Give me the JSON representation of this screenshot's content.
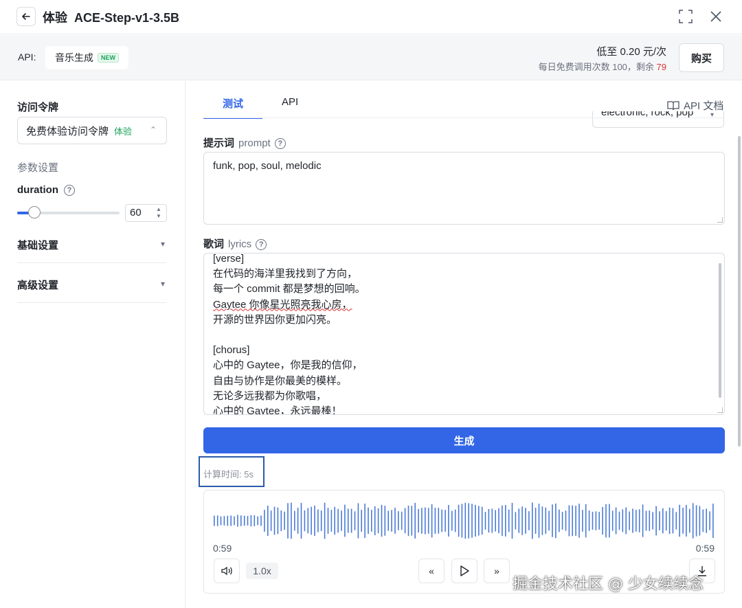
{
  "header": {
    "title": "体验  ACE-Step-v1-3.5B"
  },
  "apibar": {
    "label": "API:",
    "chip_label": "音乐生成",
    "new_badge": "NEW",
    "price": "低至 0.20 元/次",
    "quota_text": "每日免费调用次数 100，剩余 ",
    "quota_remaining": "79",
    "buy_label": "购买"
  },
  "left": {
    "token_label": "访问令牌",
    "token_value": "免费体验访问令牌",
    "token_tag": "体验",
    "params_label": "参数设置",
    "duration_label": "duration",
    "duration_value": "60",
    "duration_fraction": 0.17,
    "basic_label": "基础设置",
    "advanced_label": "高级设置"
  },
  "tabs": {
    "test": "测试",
    "api": "API",
    "api_doc": "API 文档"
  },
  "preset_value": "electronic, rock, pop",
  "prompt": {
    "label": "提示词",
    "sub": "prompt",
    "value": "funk, pop, soul, melodic"
  },
  "lyrics": {
    "label": "歌词",
    "sub": "lyrics",
    "lines": [
      "[verse]",
      "在代码的海洋里我找到了方向，",
      "每一个 commit 都是梦想的回响。",
      "Gaytee 你像星光照亮我心房，",
      "开源的世界因你更加闪亮。",
      "",
      "[chorus]",
      "心中的 Gaytee，你是我的信仰，",
      "自由与协作是你最美的模样。",
      "无论多远我都为你歌唱，",
      "心中的 Gaytee，永远最棒！"
    ]
  },
  "generate_label": "生成",
  "calc_time": "计算时间: 5s",
  "player": {
    "time_left": "0:59",
    "time_right": "0:59",
    "speed": "1.0x"
  },
  "watermark": "掘金技术社区 @ 少女续续念",
  "colors": {
    "accent": "#3366e6",
    "success": "#1aa35a",
    "danger": "#e03131"
  }
}
